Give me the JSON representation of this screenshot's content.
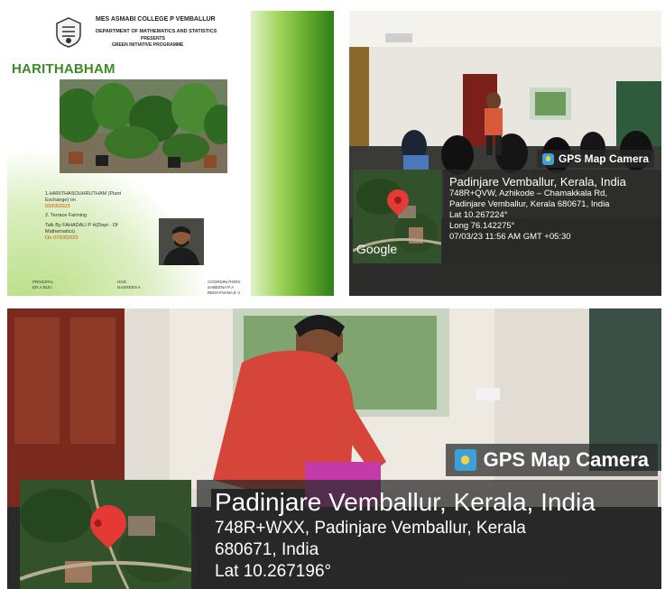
{
  "poster": {
    "college": "MES ASMABI COLLEGE P VEMBALLUR",
    "department": "DEPARTMENT OF MATHEMATICS AND STATISTICS",
    "presents": "PRESENTS",
    "programme": "GREEN INITIATIVE PROGRAMME",
    "title": "HARITHABHAM",
    "event1": "1.HARITHASOUHRUTHAM (Plant Exchange) on",
    "event1_date": "03/03/2023",
    "event2": "2. Terrace Farming",
    "talk": "Talk By FAHADALI P H(Dept - Of Mathematics)",
    "talk_date": "On 07/03/2023",
    "principal_label": "PRINCIPAL",
    "principal_name": "DR.A BIJU",
    "hod_label": "HOD",
    "hod_name": "NASREEN A",
    "coord_label": "COORDINATORS",
    "coord_name1": "SABEENA P A",
    "coord_name2": "REKHYNANA E V"
  },
  "gps_small": {
    "app": "GPS Map Camera",
    "location": "Padinjare Vemballur, Kerala, India",
    "address1": "748R+QVW, Azhikode – Chamakkala Rd,",
    "address2": "Padinjare Vemballur, Kerala 680671, India",
    "lat": "Lat 10.267224°",
    "long": "Long 76.142275°",
    "datetime": "07/03/23 11:56 AM GMT +05:30",
    "map_brand": "Google"
  },
  "gps_large": {
    "app": "GPS Map Camera",
    "location": "Padinjare Vemballur, Kerala, India",
    "address1": "748R+WXX, Padinjare Vemballur, Kerala",
    "address2": "680671, India",
    "lat": "Lat 10.267196°"
  }
}
